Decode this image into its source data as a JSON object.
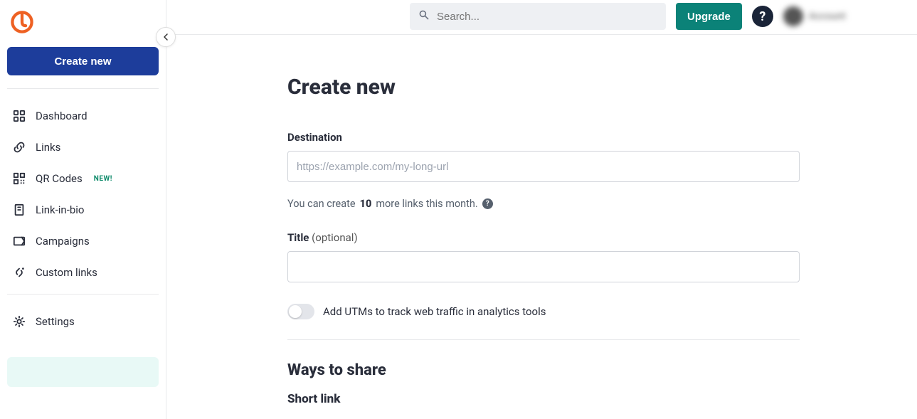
{
  "sidebar": {
    "create_label": "Create new",
    "items": [
      {
        "label": "Dashboard"
      },
      {
        "label": "Links"
      },
      {
        "label": "QR Codes",
        "badge": "NEW!"
      },
      {
        "label": "Link-in-bio"
      },
      {
        "label": "Campaigns"
      },
      {
        "label": "Custom links"
      }
    ],
    "settings_label": "Settings"
  },
  "topbar": {
    "search_placeholder": "Search...",
    "upgrade_label": "Upgrade",
    "user_name": "Account"
  },
  "page": {
    "title": "Create new",
    "destination_label": "Destination",
    "destination_placeholder": "https://example.com/my-long-url",
    "hint_prefix": "You can create",
    "hint_count": "10",
    "hint_suffix": "more links this month.",
    "title_label": "Title",
    "title_optional": " (optional)",
    "utm_toggle_label": "Add UTMs to track web traffic in analytics tools",
    "ways_title": "Ways to share",
    "shortlink_title": "Short link"
  }
}
